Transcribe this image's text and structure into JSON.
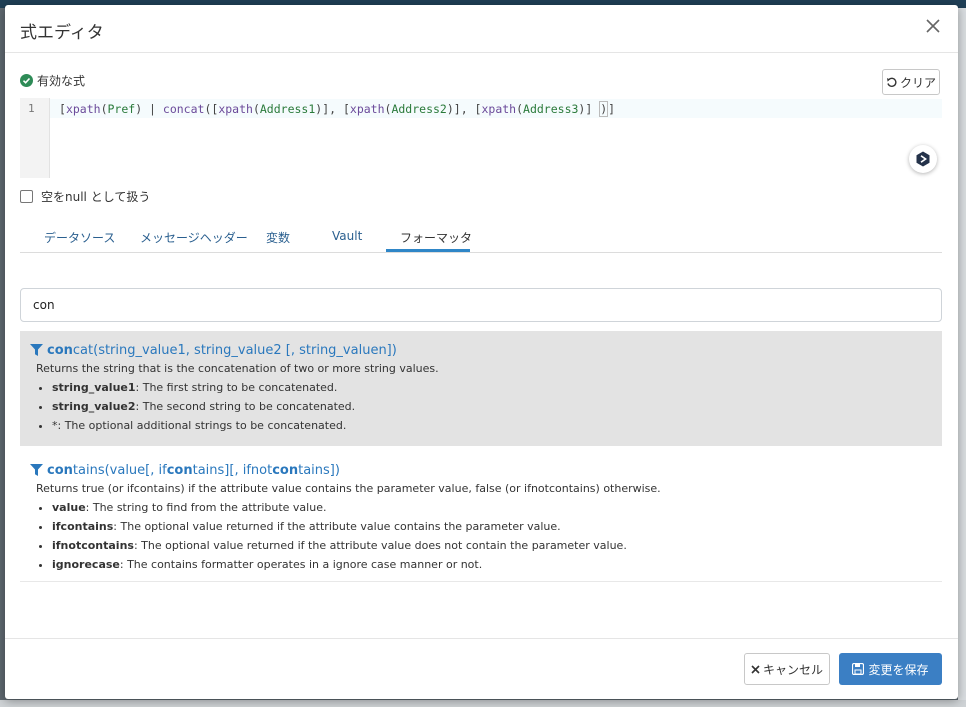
{
  "dialog": {
    "title": "式エディタ",
    "valid_label": "有効な式",
    "clear_label": "クリア",
    "line_number": "1",
    "expression": {
      "p1": "[",
      "f1": "xpath",
      "p2": "(",
      "r1": "Pref",
      "p3": ") | ",
      "f2": "concat",
      "p4": "([",
      "f3": "xpath",
      "p5": "(",
      "r2": "Address1",
      "p6": ")], [",
      "f4": "xpath",
      "p7": "(",
      "r3": "Address2",
      "p8": ")], [",
      "f5": "xpath",
      "p9": "(",
      "r4": "Address3",
      "p10": ")] ",
      "p11": ")",
      "p12": "]"
    },
    "null_checkbox_label": "空をnull として扱う",
    "tabs": [
      "データソース",
      "メッセージヘッダー",
      "変数",
      "Vault",
      "フォーマッタ"
    ],
    "active_tab": "フォーマッタ",
    "search_value": "con",
    "results": [
      {
        "sig_match": "con",
        "sig_rest": "cat(string_value1, string_value2 [, string_valuen])",
        "description": "Returns the string that is the concatenation of two or more string values.",
        "params": [
          {
            "name": "string_value1",
            "text": ": The first string to be concatenated."
          },
          {
            "name": "string_value2",
            "text": ": The second string to be concatenated."
          },
          {
            "name": "",
            "text": "*: The optional additional strings to be concatenated."
          }
        ]
      },
      {
        "sig_parts": [
          "con",
          "tains(value[, if",
          "con",
          "tains][, ifnot",
          "con",
          "tains])"
        ],
        "description": "Returns true (or ifcontains) if the attribute value contains the parameter value, false (or ifnotcontains) otherwise.",
        "params": [
          {
            "name": "value",
            "text": ": The string to find from the attribute value."
          },
          {
            "name": "ifcontains",
            "text": ": The optional value returned if the attribute value contains the parameter value."
          },
          {
            "name": "ifnotcontains",
            "text": ": The optional value returned if the attribute value does not contain the parameter value."
          },
          {
            "name": "ignorecase",
            "text": ": The contains formatter operates in a ignore case manner or not."
          }
        ]
      }
    ],
    "cancel_label": "キャンセル",
    "save_label": "変更を保存"
  },
  "colors": {
    "accent": "#3b7fc4",
    "link": "#2a78bd",
    "valid": "#2e8b57",
    "highlight_row": "#e3e3e3"
  },
  "icons": [
    "check-circle-icon",
    "close-icon",
    "undo-icon",
    "ai-assistant-icon",
    "filter-icon",
    "times-icon",
    "save-icon"
  ]
}
